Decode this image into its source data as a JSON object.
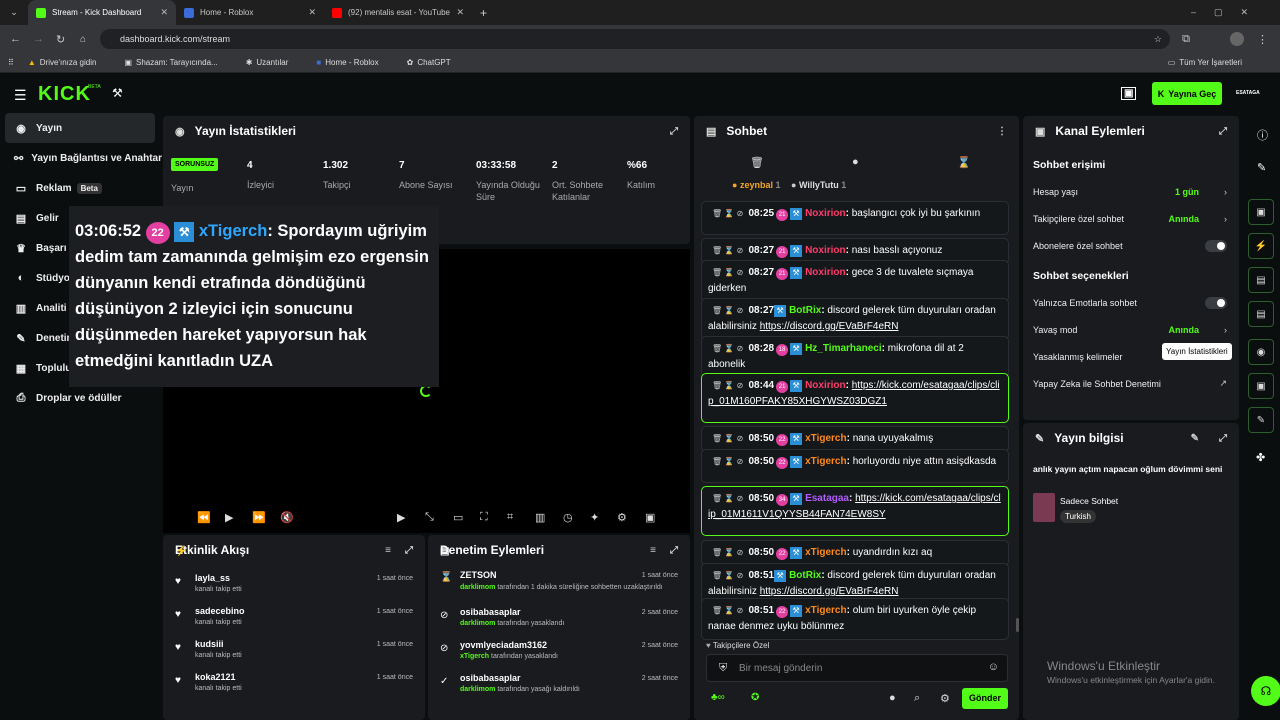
{
  "browser": {
    "tabs": [
      {
        "title": "Stream - Kick Dashboard",
        "color": "#53fc18"
      },
      {
        "title": "Home - Roblox",
        "color": "#3b6bd6"
      },
      {
        "title": "(92) mentalis esat - YouTube",
        "color": "#ff0000"
      }
    ],
    "url": "dashboard.kick.com/stream",
    "bookmarks": [
      "Drive'ınıza gidin",
      "Shazam: Tarayıcında...",
      "Uzantılar",
      "Home - Roblox",
      "ChatGPT"
    ],
    "all_bookmarks": "Tüm Yer İşaretleri"
  },
  "header": {
    "logo": "KICK",
    "logo_beta": "BETA",
    "go_live": "Yayına Geç",
    "user": "ESATAGA"
  },
  "sidebar": {
    "items": [
      {
        "label": "Yayın",
        "icon": "circle-dot-icon"
      },
      {
        "label": "Yayın Bağlantısı ve Anahtar",
        "icon": "link-icon"
      },
      {
        "label": "Reklam",
        "icon": "monitor-icon",
        "badge": "Beta"
      },
      {
        "label": "Gelir",
        "icon": "chart-icon"
      },
      {
        "label": "Başarı",
        "icon": "trophy-icon"
      },
      {
        "label": "Stüdyo",
        "icon": "studio-icon"
      },
      {
        "label": "Analiti",
        "icon": "analytics-icon"
      },
      {
        "label": "Denetim",
        "icon": "wrench-icon"
      },
      {
        "label": "Topluluk",
        "icon": "community-icon"
      },
      {
        "label": "Droplar ve ödüller",
        "icon": "gift-icon"
      }
    ]
  },
  "stats": {
    "title": "Yayın İstatistikleri",
    "status": "SORUNSUZ",
    "status_label": "Yayın",
    "items": [
      {
        "value": "4",
        "label": "İzleyici"
      },
      {
        "value": "1.302",
        "label": "Takipçi"
      },
      {
        "value": "7",
        "label": "Abone Sayısı"
      },
      {
        "value": "03:33:58",
        "label": "Yayında Olduğu Süre"
      },
      {
        "value": "2",
        "label": "Ort. Sohbete Katılanlar"
      },
      {
        "value": "%66",
        "label": "Katılım"
      }
    ]
  },
  "overlay": {
    "time": "03:06:52",
    "badge": "22",
    "user": "xTigerch",
    "text": "Spordayım uğriyim dedim tam zamanında gelmişim ezo ergensin dünyanın kendi etrafında döndüğünü düşünüyon 2 izleyici için sonucunu düşünmeden hareket yapıyorsun hak etmedğini kanıtladın UZA"
  },
  "activity": {
    "title": "Etkinlik Akışı",
    "rows": [
      {
        "name": "layla_ss",
        "sub": "kanalı takip etti",
        "time": "1 saat önce"
      },
      {
        "name": "sadecebino",
        "sub": "kanalı takip etti",
        "time": "1 saat önce"
      },
      {
        "name": "kudsiii",
        "sub": "kanalı takip etti",
        "time": "1 saat önce"
      },
      {
        "name": "koka2121",
        "sub": "kanalı takip etti",
        "time": "1 saat önce"
      }
    ]
  },
  "moderation": {
    "title": "Denetim Eylemleri",
    "rows": [
      {
        "name": "ZETSON",
        "by": "darklimom",
        "sub": " tarafından 1 dakika süreliğine sohbetten uzaklaştırıldı",
        "time": "1 saat önce"
      },
      {
        "name": "osibabasaplar",
        "by": "darklimom",
        "sub": " tarafından yasaklandı",
        "time": "2 saat önce"
      },
      {
        "name": "yovmlyeciadam3162",
        "by": "xTigerch",
        "sub": " tarafından yasaklandı",
        "time": "2 saat önce"
      },
      {
        "name": "osibabasaplar",
        "by": "darklimom",
        "sub": " tarafından yasağı kaldırıldı",
        "time": "2 saat önce"
      }
    ]
  },
  "chat": {
    "title": "Sohbet",
    "top": [
      {
        "name": "zeynbal",
        "count": "1"
      },
      {
        "name": "WillyTutu",
        "count": "1"
      }
    ],
    "messages": [
      {
        "time": "08:25",
        "badge": "21",
        "user": "Noxirion",
        "ucolor": "#ff3b6b",
        "text": "başlangıcı çok iyi bu şarkının"
      },
      {
        "time": "08:27",
        "badge": "21",
        "user": "Noxirion",
        "ucolor": "#ff3b6b",
        "text": "nası basslı açıyonuz"
      },
      {
        "time": "08:27",
        "badge": "21",
        "user": "Noxirion",
        "ucolor": "#ff3b6b",
        "text": "gece 3 de tuvalete sıçmaya giderken"
      },
      {
        "time": "08:27",
        "badge": "",
        "user": "BotRix",
        "ucolor": "#53fc18",
        "text": "discord gelerek tüm duyuruları oradan alabilirsiniz ",
        "link": "https://discord.gg/EVaBrF4eRN"
      },
      {
        "time": "08:28",
        "badge": "18",
        "user": "Hz_Timarhaneci",
        "ucolor": "#53fc18",
        "text": "mikrofona dil at 2 abonelik"
      },
      {
        "time": "08:44",
        "badge": "21",
        "user": "Noxirion",
        "ucolor": "#ff3b6b",
        "text": "",
        "link": "https://kick.com/esatagaa/clips/clip_01M160PFAKY85XHGYWSZ03DGZ1"
      },
      {
        "time": "08:50",
        "badge": "22",
        "user": "xTigerch",
        "ucolor": "#ff8a1f",
        "text": "nana uyuyakalmış"
      },
      {
        "time": "08:50",
        "badge": "22",
        "user": "xTigerch",
        "ucolor": "#ff8a1f",
        "text": "horluyordu niye attın asişdkasda"
      },
      {
        "time": "08:50",
        "badge": "34",
        "user": "Esatagaa",
        "ucolor": "#b45cff",
        "text": "",
        "link": "https://kick.com/esatagaa/clips/clip_01M1611V1QYYSB44FAN74EW8SY"
      },
      {
        "time": "08:50",
        "badge": "22",
        "user": "xTigerch",
        "ucolor": "#ff8a1f",
        "text": "uyandırdın kızı aq"
      },
      {
        "time": "08:51",
        "badge": "",
        "user": "BotRix",
        "ucolor": "#53fc18",
        "text": "discord gelerek tüm duyuruları oradan alabilirsiniz ",
        "link": "https://discord.gg/EVaBrF4eRN"
      },
      {
        "time": "08:51",
        "badge": "22",
        "user": "xTigerch",
        "ucolor": "#ff8a1f",
        "text": "olum biri uyurken öyle çekip nanae denmez uyku bölünmez"
      }
    ],
    "followers_only": "Takipçilere Özel",
    "placeholder": "Bir mesaj gönderin",
    "send": "Gönder"
  },
  "channel": {
    "title": "Kanal Eylemleri",
    "sec1": "Sohbet erişimi",
    "account_age": "Hesap yaşı",
    "account_age_val": "1 gün",
    "followers": "Takipçilere özel sohbet",
    "followers_val": "Anında",
    "subs": "Abonelere özel sohbet",
    "sec2": "Sohbet seçenekleri",
    "emotes": "Yalnızca Emotlarla sohbet",
    "slow": "Yavaş mod",
    "slow_val": "Anında",
    "banned": "Yasaklanmış kelimeler",
    "ai": "Yapay Zeka ile Sohbet Denetimi",
    "tooltip": "Yayın İstatistikleri"
  },
  "info": {
    "title": "Yayın bilgisi",
    "stream_title": "anlık yayın açtım napacan oğlum dövimmi seni",
    "category": "Sadece Sohbet",
    "tag": "Turkish"
  },
  "windows": {
    "line1": "Windows'u Etkinleştir",
    "line2": "Windows'u etkinleştirmek için Ayarlar'a gidin."
  }
}
